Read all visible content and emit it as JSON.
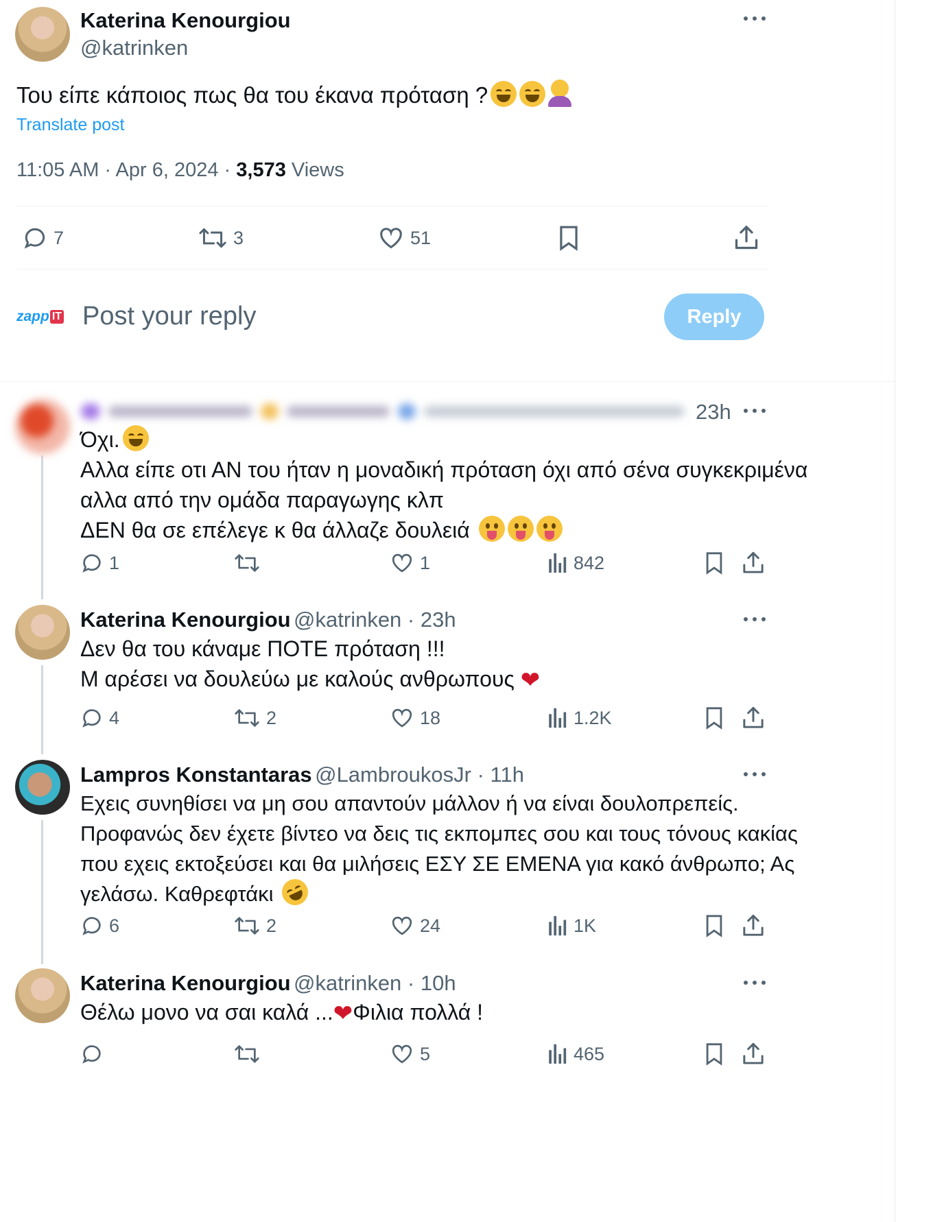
{
  "main_post": {
    "author_name": "Katerina Kenourgiou",
    "author_handle": "@katrinken",
    "text": "Του είπε κάποιος πως θα του έκανα πρόταση ?",
    "translate_label": "Translate post",
    "time": "11:05 AM · Apr 6, 2024 · ",
    "views_count": "3,573",
    "views_label": " Views",
    "stats": {
      "replies": "7",
      "reposts": "3",
      "likes": "51"
    }
  },
  "composer": {
    "logo_text": "zapp",
    "logo_badge": "IT",
    "placeholder": "Post your reply",
    "reply_button": "Reply"
  },
  "replies": [
    {
      "author_name": "",
      "author_handle": "",
      "time": "23h",
      "lines": [
        "Όχι.",
        "Αλλα είπε οτι ΑΝ του ήταν η μοναδική πρόταση όχι από σένα συγκεκριμένα",
        "αλλα από την ομάδα παραγωγης κλπ",
        "ΔΕΝ θα σε επέλεγε κ θα άλλαζε δουλειά"
      ],
      "stats": {
        "replies": "1",
        "reposts": "",
        "likes": "1",
        "views": "842"
      }
    },
    {
      "author_name": "Katerina Kenourgiou",
      "author_handle": "@katrinken · 23h",
      "lines": [
        "Δεν θα του κάναμε ΠΟΤΕ πρόταση !!!",
        "Μ αρέσει να δουλεύω με καλούς ανθρωπους"
      ],
      "stats": {
        "replies": "4",
        "reposts": "2",
        "likes": "18",
        "views": "1.2K"
      }
    },
    {
      "author_name": "Lampros Konstantaras",
      "author_handle": "@LambroukosJr · 11h",
      "lines": [
        "Εχεις συνηθίσει να μη σου απαντούν μάλλον ή να είναι δουλοπρεπείς.",
        "Προφανώς δεν έχετε βίντεο να δεις τις εκπομπες σου και τους τόνους κακίας",
        "που εχεις εκτοξεύσει και θα μιλήσεις ΕΣΥ ΣΕ ΕΜΕΝΑ για κακό άνθρωπο; Ας",
        "γελάσω. Καθρεφτάκι"
      ],
      "stats": {
        "replies": "6",
        "reposts": "2",
        "likes": "24",
        "views": "1K"
      }
    },
    {
      "author_name": "Katerina Kenourgiou",
      "author_handle": "@katrinken · 10h",
      "lines": [
        "Θέλω μονο να σαι καλά ...",
        "Φιλια πολλά !"
      ],
      "stats": {
        "replies": "",
        "reposts": "",
        "likes": "5",
        "views": "465"
      }
    }
  ],
  "colors": {
    "accent": "#1d9bf0",
    "reply_button_bg": "#8ecdf8",
    "muted": "#536471",
    "heart": "#d1152a"
  }
}
